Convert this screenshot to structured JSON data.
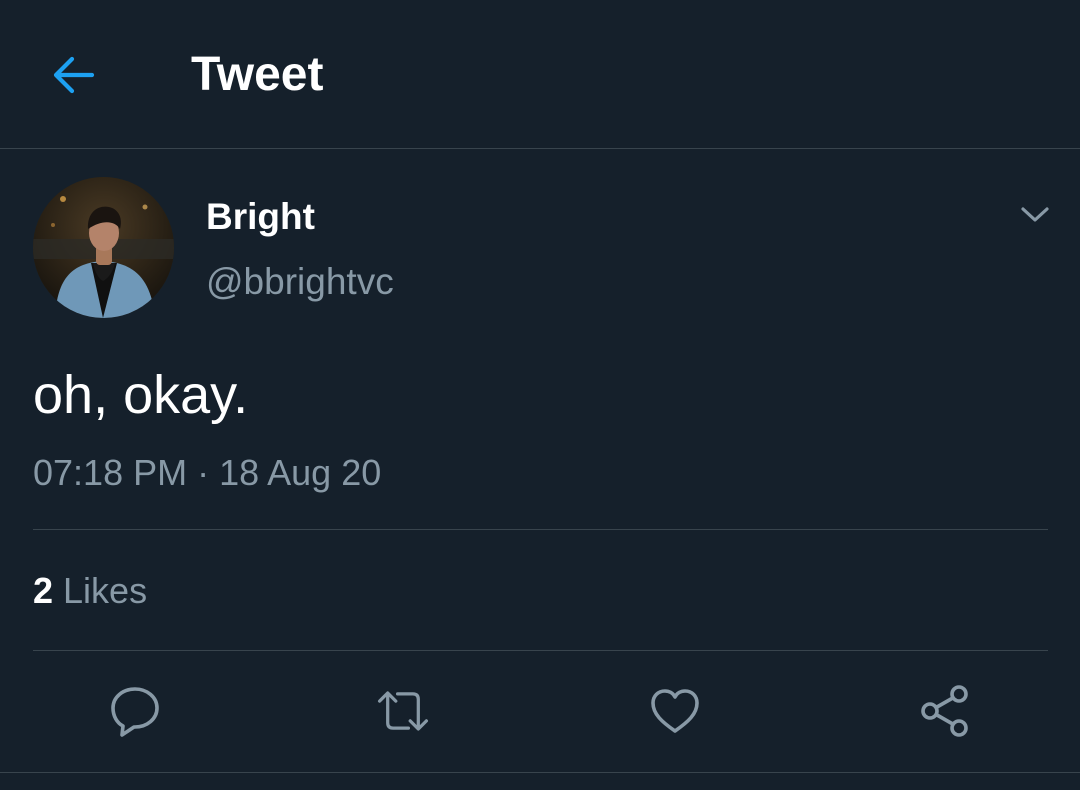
{
  "header": {
    "title": "Tweet",
    "back_icon": "arrow-left-icon",
    "accent_color": "#1da1f2"
  },
  "tweet": {
    "author": {
      "display_name": "Bright",
      "handle": "@bbrightvc",
      "avatar_icon": "profile-photo"
    },
    "text": "oh, okay.",
    "timestamp": "07:18 PM · 18 Aug 20",
    "more_icon": "chevron-down-icon"
  },
  "stats": {
    "likes_count": "2",
    "likes_label": "Likes"
  },
  "actions": [
    {
      "name": "reply",
      "icon": "reply-icon"
    },
    {
      "name": "retweet",
      "icon": "retweet-icon"
    },
    {
      "name": "like",
      "icon": "heart-icon"
    },
    {
      "name": "share",
      "icon": "share-icon"
    }
  ],
  "theme": {
    "background": "#15202b",
    "border": "#38444d",
    "secondary_text": "#8899a6",
    "primary_text": "#ffffff"
  }
}
